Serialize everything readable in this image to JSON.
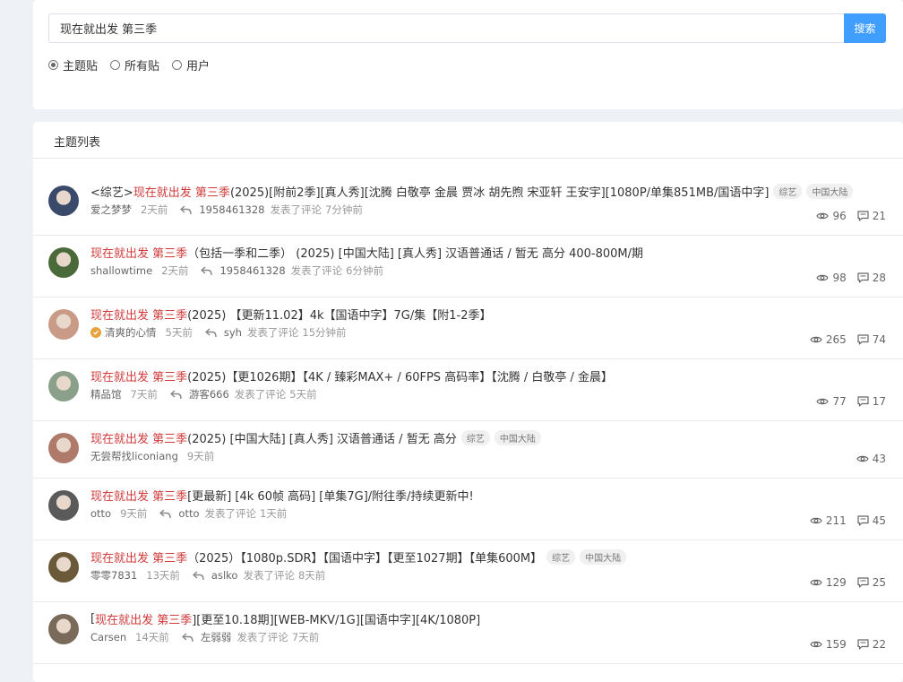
{
  "search": {
    "value": "现在就出发 第三季",
    "button": "搜索",
    "options": [
      {
        "label": "主题贴",
        "checked": true
      },
      {
        "label": "所有贴",
        "checked": false
      },
      {
        "label": "用户",
        "checked": false
      }
    ]
  },
  "list": {
    "header": "主题列表",
    "topics": [
      {
        "prefix": "<综艺>",
        "highlight": "现在就出发 第三季",
        "rest": " (2025)[附前2季][真人秀][沈腾 白敬亭 金晨 贾冰 胡先煦 宋亚轩 王安宇][1080P/单集851MB/国语中字]",
        "tags": [
          "综艺",
          "中国大陆"
        ],
        "author": "爱之梦梦",
        "time": "2天前",
        "replier": "1958461328",
        "reply_text": "发表了评论",
        "reply_time": "7分钟前",
        "views": "96",
        "comments": "21",
        "avatar_color": "#3a4a6b"
      },
      {
        "prefix": "",
        "highlight": "现在就出发 第三季",
        "rest": "（包括一季和二季） (2025) [中国大陆] [真人秀] 汉语普通话 / 暂无 高分 400-800M/期",
        "tags": [],
        "author": "shallowtime",
        "time": "2天前",
        "replier": "1958461328",
        "reply_text": "发表了评论",
        "reply_time": "6分钟前",
        "views": "98",
        "comments": "28",
        "avatar_color": "#4a6a3a"
      },
      {
        "prefix": "",
        "highlight": "现在就出发 第三季",
        "rest": " (2025) 【更新11.02】4k【国语中字】7G/集【附1-2季】",
        "tags": [],
        "author": "清爽的心情",
        "time": "5天前",
        "replier": "syh",
        "reply_text": "发表了评论",
        "reply_time": "15分钟前",
        "views": "265",
        "comments": "74",
        "avatar_color": "#c99a86"
      },
      {
        "prefix": "",
        "highlight": "现在就出发 第三季",
        "rest": " (2025)【更1026期】【4K / 臻彩MAX+ / 60FPS 高码率】【沈腾 / 白敬亭 / 金晨】",
        "tags": [],
        "author": "精品馆",
        "time": "7天前",
        "replier": "游客666",
        "reply_text": "发表了评论",
        "reply_time": "5天前",
        "views": "77",
        "comments": "17",
        "avatar_color": "#8aa08a"
      },
      {
        "prefix": "",
        "highlight": "现在就出发 第三季",
        "rest": " (2025) [中国大陆] [真人秀] 汉语普通话 / 暂无 高分",
        "tags": [
          "综艺",
          "中国大陆"
        ],
        "author": "无尝帮找liconiang",
        "time": "9天前",
        "replier": "",
        "reply_text": "",
        "reply_time": "",
        "views": "43",
        "comments": "",
        "avatar_color": "#b07a6a"
      },
      {
        "prefix": "",
        "highlight": "现在就出发 第三季",
        "rest": " [更最新] [4k 60帧 高码] [单集7G]/附往季/持续更新中!",
        "tags": [],
        "author": "otto",
        "time": "9天前",
        "replier": "otto",
        "reply_text": "发表了评论",
        "reply_time": "1天前",
        "views": "211",
        "comments": "45",
        "avatar_color": "#5a5a5a"
      },
      {
        "prefix": "",
        "highlight": "现在就出发 第三季",
        "rest": "（2025）【1080p.SDR】【国语中字】【更至1027期】【单集600M】",
        "tags": [
          "综艺",
          "中国大陆"
        ],
        "author": "零零7831",
        "time": "13天前",
        "replier": "aslko",
        "reply_text": "发表了评论",
        "reply_time": "8天前",
        "views": "129",
        "comments": "25",
        "avatar_color": "#6b5a3a"
      },
      {
        "prefix": "[",
        "highlight": "现在就出发 第三季",
        "rest": "][更至10.18期][WEB-MKV/1G][国语中字][4K/1080P]",
        "tags": [],
        "author": "Carsen",
        "time": "14天前",
        "replier": "左弱弱",
        "reply_text": "发表了评论",
        "reply_time": "7天前",
        "views": "159",
        "comments": "22",
        "avatar_color": "#7a6a5a"
      }
    ]
  },
  "colors": {
    "accent": "#409eff",
    "highlight": "#d03a3a",
    "verified": "#e6a23c"
  }
}
